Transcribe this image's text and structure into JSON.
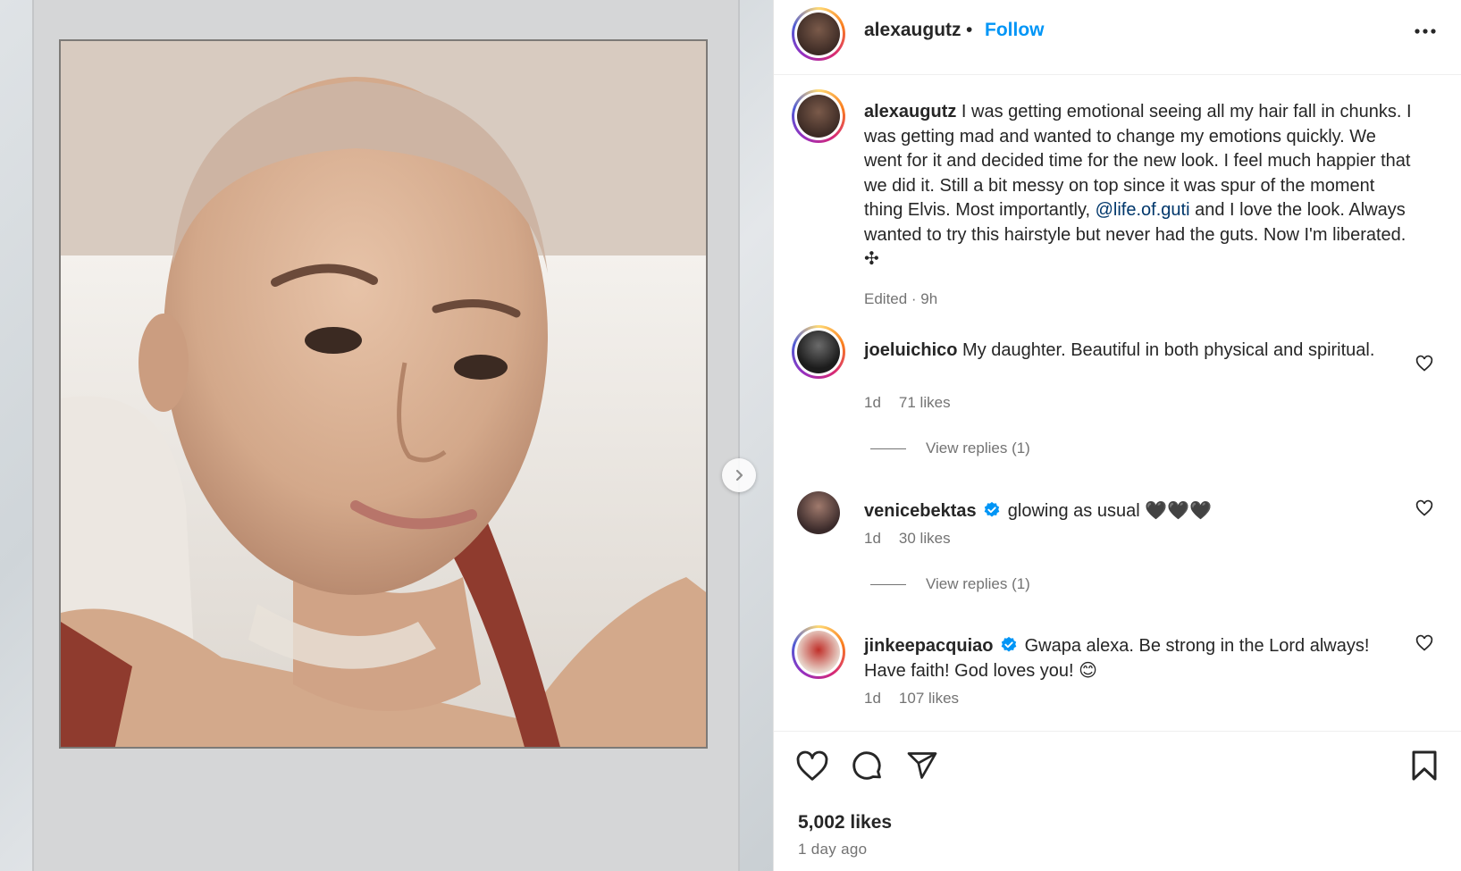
{
  "post": {
    "username": "alexaugutz",
    "follow_label": "Follow",
    "separator": "•",
    "caption": {
      "username": "alexaugutz",
      "text_before_mention": "I was getting emotional seeing all my hair fall in chunks. I was getting mad and wanted to change my emotions quickly. We went for it and decided time for the new look. I feel much happier that we did it. Still a bit messy on top since it was spur of the moment thing Elvis. Most importantly, ",
      "mention": "@life.of.guti",
      "text_after_mention": " and I love the look. Always wanted to try this hairstyle but never had the guts. Now I'm liberated. ✣",
      "meta": "Edited · 9h"
    },
    "likes": "5,002 likes",
    "time_ago": "1 day ago"
  },
  "comments": [
    {
      "username": "joeluichico",
      "text": "My daughter. Beautiful in both physical and spiritual.",
      "age": "1d",
      "likes": "71 likes",
      "view_replies": "View replies (1)",
      "verified": false
    },
    {
      "username": "venicebektas",
      "text": "glowing as usual 🖤🖤🖤",
      "age": "1d",
      "likes": "30 likes",
      "view_replies": "View replies (1)",
      "verified": true
    },
    {
      "username": "jinkeepacquiao",
      "text": "Gwapa alexa. Be strong in the Lord always! Have faith! God loves you! 😊",
      "age": "1d",
      "likes": "107 likes",
      "verified": true
    }
  ],
  "icons": {
    "more": "more-options-icon",
    "like": "heart-icon",
    "comment": "comment-icon",
    "share": "send-icon",
    "save": "bookmark-icon",
    "next": "chevron-right-icon",
    "verified": "verified-badge-icon"
  },
  "colors": {
    "link_blue": "#0095f6",
    "mention": "#00376b",
    "verified": "#0095f6",
    "muted_text": "#737373"
  }
}
